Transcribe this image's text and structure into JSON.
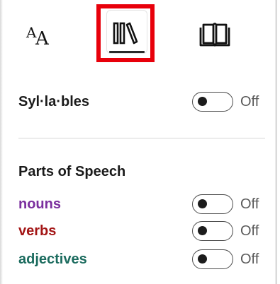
{
  "toolbar": {
    "tabs": [
      {
        "name": "text-preferences",
        "icon": "text-size-icon",
        "glyph_small": "A",
        "glyph_big": "A"
      },
      {
        "name": "grammar-options",
        "icon": "books-icon",
        "selected": true
      },
      {
        "name": "reading-preferences",
        "icon": "open-book-icon"
      }
    ]
  },
  "syllables": {
    "label": "Syl·la·bles",
    "state": "Off",
    "on": false
  },
  "parts_of_speech": {
    "title": "Parts of Speech",
    "items": [
      {
        "label": "nouns",
        "color": "#7b2f9e",
        "state": "Off",
        "on": false
      },
      {
        "label": "verbs",
        "color": "#a31515",
        "state": "Off",
        "on": false
      },
      {
        "label": "adjectives",
        "color": "#1b6b5e",
        "state": "Off",
        "on": false
      }
    ]
  },
  "colors": {
    "highlight": "#e8000b",
    "label_text": "#1a1a1a",
    "state_text": "#5a5a5a"
  }
}
